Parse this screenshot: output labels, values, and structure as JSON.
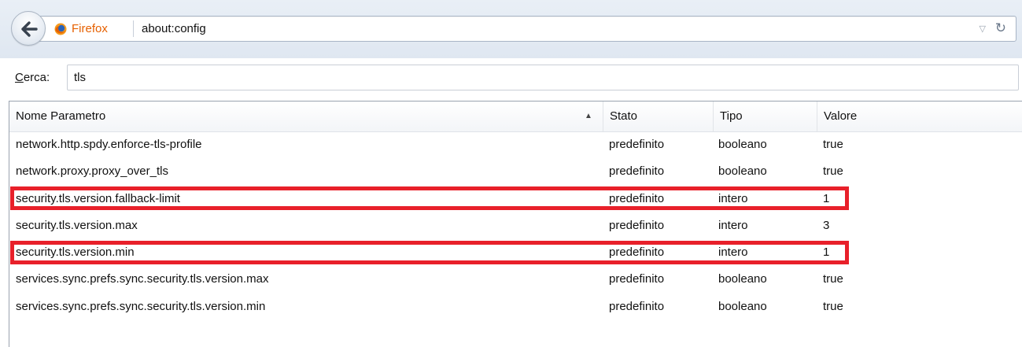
{
  "navbar": {
    "identity_label": "Firefox",
    "url": "about:config"
  },
  "search": {
    "label_access": "C",
    "label_rest": "erca:",
    "value": "tls"
  },
  "table": {
    "columns": {
      "name": "Nome Parametro",
      "stato": "Stato",
      "tipo": "Tipo",
      "valore": "Valore"
    },
    "sorted_column": "Nome Parametro",
    "rows": [
      {
        "name": "network.http.spdy.enforce-tls-profile",
        "stato": "predefinito",
        "tipo": "booleano",
        "valore": "true",
        "highlighted": false
      },
      {
        "name": "network.proxy.proxy_over_tls",
        "stato": "predefinito",
        "tipo": "booleano",
        "valore": "true",
        "highlighted": false
      },
      {
        "name": "security.tls.version.fallback-limit",
        "stato": "predefinito",
        "tipo": "intero",
        "valore": "1",
        "highlighted": true
      },
      {
        "name": "security.tls.version.max",
        "stato": "predefinito",
        "tipo": "intero",
        "valore": "3",
        "highlighted": false
      },
      {
        "name": "security.tls.version.min",
        "stato": "predefinito",
        "tipo": "intero",
        "valore": "1",
        "highlighted": true
      },
      {
        "name": "services.sync.prefs.sync.security.tls.version.max",
        "stato": "predefinito",
        "tipo": "booleano",
        "valore": "true",
        "highlighted": false
      },
      {
        "name": "services.sync.prefs.sync.security.tls.version.min",
        "stato": "predefinito",
        "tipo": "booleano",
        "valore": "true",
        "highlighted": false
      }
    ]
  },
  "colors": {
    "highlight_border": "#e8202a",
    "identity_label": "#e66000",
    "navbar_background": "#e3eaf3"
  }
}
